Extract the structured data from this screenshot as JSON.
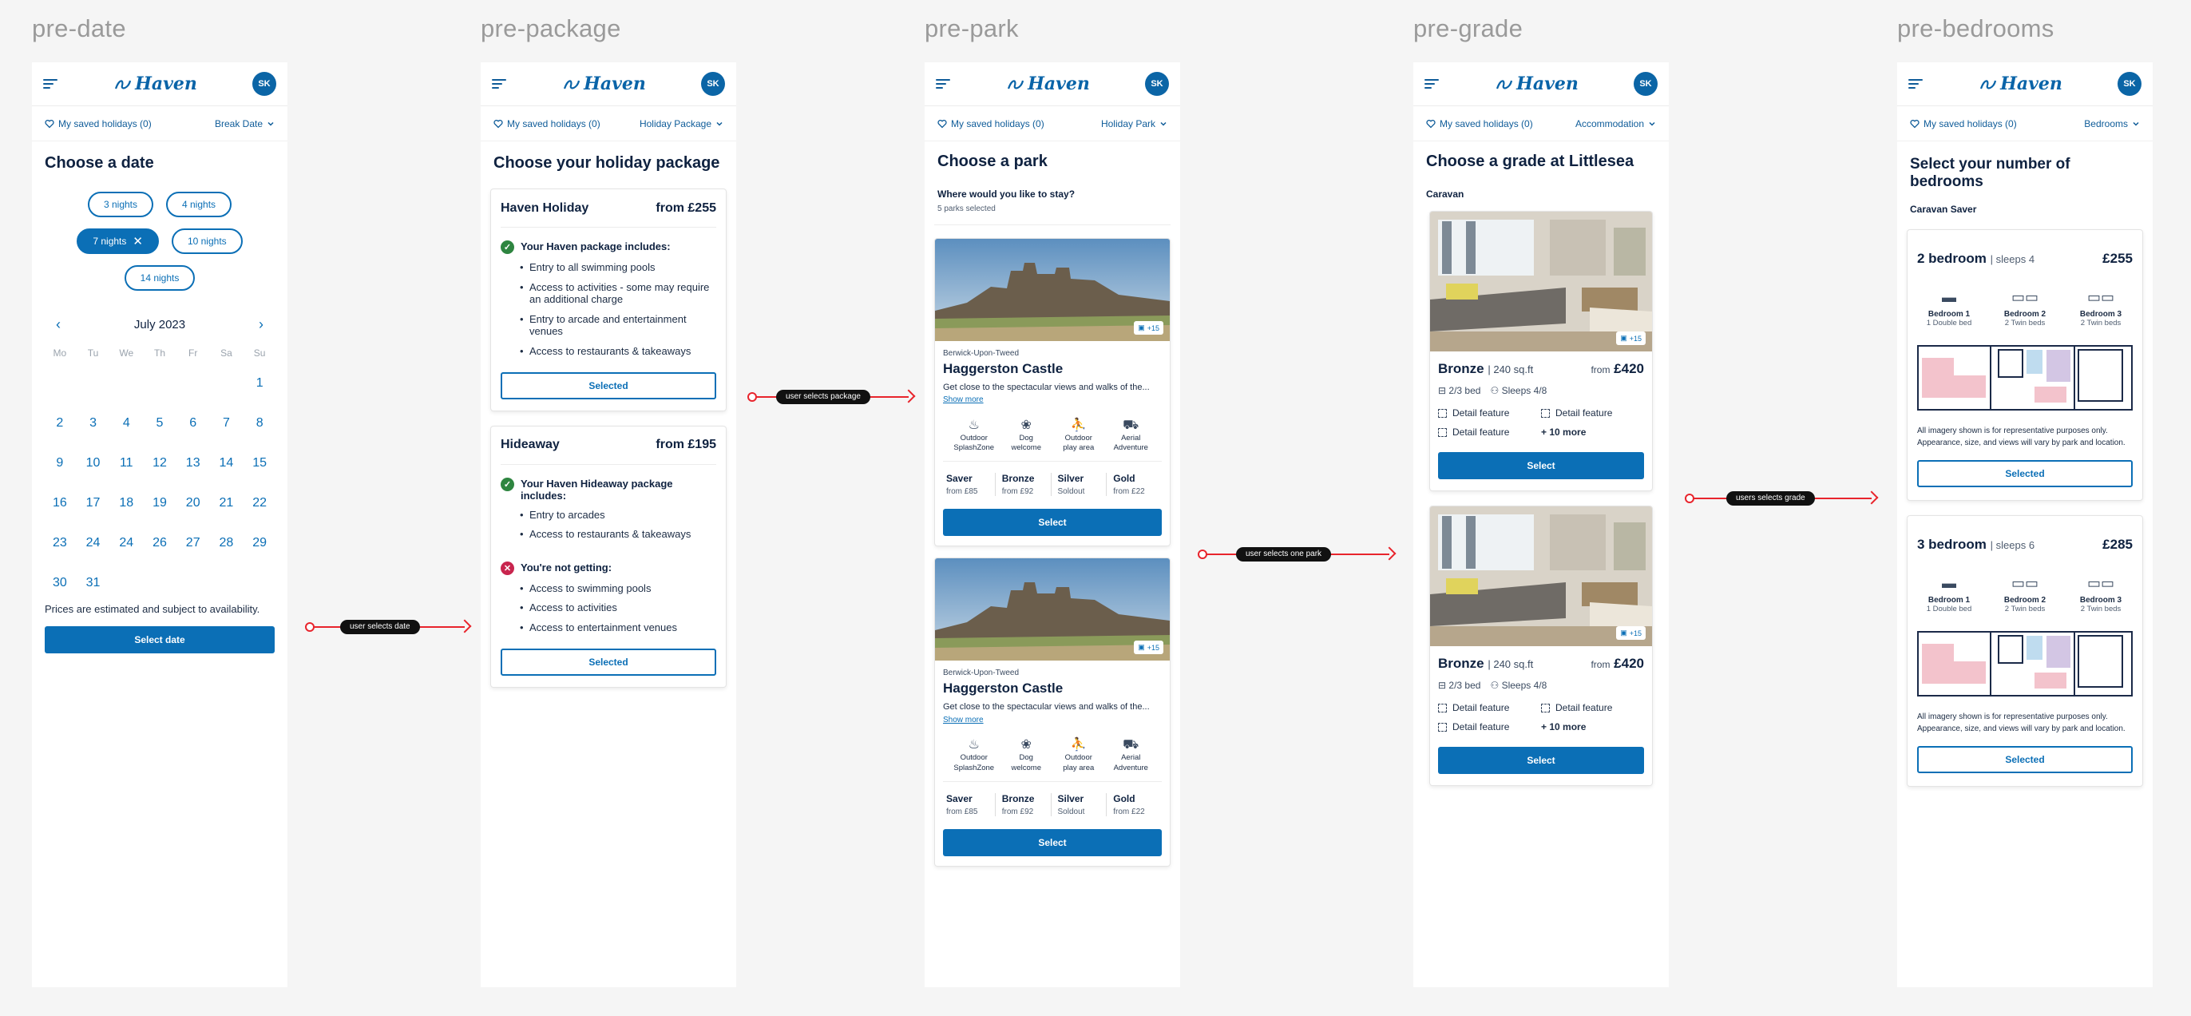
{
  "brand": {
    "logo": "Haven",
    "avatar": "SK",
    "saved": "My saved holidays (0)"
  },
  "frames": {
    "date": {
      "label": "pre-date",
      "filter": "Break Date",
      "title": "Choose a date",
      "chips": [
        "3 nights",
        "4 nights",
        "7 nights",
        "10 nights",
        "14 nights"
      ],
      "selected_chip": "7 nights",
      "month": "July 2023",
      "weekdays": [
        "Mo",
        "Tu",
        "We",
        "Th",
        "Fr",
        "Sa",
        "Su"
      ],
      "days": [
        "",
        "",
        "",
        "",
        "",
        "",
        "1",
        "2",
        "3",
        "4",
        "5",
        "6",
        "7",
        "8",
        "9",
        "10",
        "11",
        "12",
        "13",
        "14",
        "15",
        "16",
        "17",
        "18",
        "19",
        "20",
        "21",
        "22",
        "23",
        "24",
        "24",
        "26",
        "27",
        "28",
        "29",
        "30",
        "31"
      ],
      "note": "Prices are estimated and subject to availability.",
      "cta": "Select date"
    },
    "package": {
      "label": "pre-package",
      "filter": "Holiday Package",
      "title": "Choose your holiday package",
      "packages": [
        {
          "name": "Haven Holiday",
          "price": "from £255",
          "includes_title": "Your Haven package includes:",
          "includes": [
            "Entry to all swimming pools",
            "Access to activities - some may require an additional charge",
            "Entry to arcade and entertainment venues",
            "Access to restaurants & takeaways"
          ],
          "cta": "Selected"
        },
        {
          "name": "Hideaway",
          "price": "from £195",
          "includes_title": "Your Haven Hideaway package includes:",
          "includes": [
            "Entry to arcades",
            "Access to restaurants & takeaways"
          ],
          "excludes_title": "You're not getting:",
          "excludes": [
            "Access to swimming pools",
            "Access to activities",
            "Access to entertainment venues"
          ],
          "cta": "Selected"
        }
      ]
    },
    "park": {
      "label": "pre-park",
      "filter": "Holiday Park",
      "title": "Choose a park",
      "question": "Where would you like to stay?",
      "count": "5 parks selected",
      "parks": [
        {
          "badge": "+15",
          "location": "Berwick-Upon-Tweed",
          "name": "Haggerston Castle",
          "desc": "Get close to the spectacular views and walks of the...",
          "more": "Show more",
          "features": [
            {
              "icon": "splash-icon",
              "glyph": "♨",
              "line1": "Outdoor",
              "line2": "SplashZone"
            },
            {
              "icon": "dog-icon",
              "glyph": "❀",
              "line1": "Dog",
              "line2": "welcome"
            },
            {
              "icon": "playground-icon",
              "glyph": "⛹",
              "line1": "Outdoor",
              "line2": "play area"
            },
            {
              "icon": "aerial-icon",
              "glyph": "⛟",
              "line1": "Aerial",
              "line2": "Adventure"
            }
          ],
          "grades": [
            {
              "name": "Saver",
              "price": "from £85"
            },
            {
              "name": "Bronze",
              "price": "from £92"
            },
            {
              "name": "Silver",
              "price": "Soldout"
            },
            {
              "name": "Gold",
              "price": "from £22"
            }
          ],
          "cta": "Select"
        },
        {
          "badge": "+15",
          "location": "Berwick-Upon-Tweed",
          "name": "Haggerston Castle",
          "desc": "Get close to the spectacular views and walks of the...",
          "more": "Show more",
          "features": [
            {
              "icon": "splash-icon",
              "glyph": "♨",
              "line1": "Outdoor",
              "line2": "SplashZone"
            },
            {
              "icon": "dog-icon",
              "glyph": "❀",
              "line1": "Dog",
              "line2": "welcome"
            },
            {
              "icon": "playground-icon",
              "glyph": "⛹",
              "line1": "Outdoor",
              "line2": "play area"
            },
            {
              "icon": "aerial-icon",
              "glyph": "⛟",
              "line1": "Aerial",
              "line2": "Adventure"
            }
          ],
          "grades": [
            {
              "name": "Saver",
              "price": "from £85"
            },
            {
              "name": "Bronze",
              "price": "from £92"
            },
            {
              "name": "Silver",
              "price": "Soldout"
            },
            {
              "name": "Gold",
              "price": "from £22"
            }
          ],
          "cta": "Select"
        }
      ]
    },
    "grade": {
      "label": "pre-grade",
      "filter": "Accommodation",
      "title": "Choose a grade at Littlesea",
      "category": "Caravan",
      "cards": [
        {
          "badge": "+15",
          "name": "Bronze",
          "size": "| 240 sq.ft",
          "from": "from",
          "price": "£420",
          "beds": "2/3 bed",
          "sleeps": "Sleeps 4/8",
          "features": [
            "Detail feature",
            "Detail feature",
            "Detail feature",
            "+ 10 more"
          ],
          "cta": "Select"
        },
        {
          "badge": "+15",
          "name": "Bronze",
          "size": "| 240 sq.ft",
          "from": "from",
          "price": "£420",
          "beds": "2/3 bed",
          "sleeps": "Sleeps 4/8",
          "features": [
            "Detail feature",
            "Detail feature",
            "Detail feature",
            "+ 10 more"
          ],
          "cta": "Select"
        }
      ]
    },
    "bedrooms": {
      "label": "pre-bedrooms",
      "filter": "Bedrooms",
      "title": "Select your number of bedrooms",
      "category": "Caravan Saver",
      "cards": [
        {
          "name": "2 bedroom",
          "sleeps": "| sleeps 4",
          "price": "£255",
          "rooms": [
            {
              "name": "Bedroom 1",
              "beds": "1 Double bed"
            },
            {
              "name": "Bedroom 2",
              "beds": "2 Twin beds"
            },
            {
              "name": "Bedroom 3",
              "beds": "2 Twin beds"
            }
          ],
          "disclaimer": "All imagery shown is for representative purposes only. Appearance, size, and views will vary by park and location.",
          "cta": "Selected"
        },
        {
          "name": "3 bedroom",
          "sleeps": "| sleeps 6",
          "price": "£285",
          "rooms": [
            {
              "name": "Bedroom 1",
              "beds": "1 Double bed"
            },
            {
              "name": "Bedroom 2",
              "beds": "2 Twin beds"
            },
            {
              "name": "Bedroom 3",
              "beds": "2 Twin beds"
            }
          ],
          "disclaimer": "All imagery shown is for representative purposes only. Appearance, size, and views will vary by park and location.",
          "cta": "Selected"
        }
      ]
    }
  },
  "flows": [
    "user selects date",
    "user selects package",
    "user selects one park",
    "users selects grade"
  ],
  "colors": {
    "primary": "#0b6fb6",
    "navy": "#0f2240",
    "flow_red": "#e8242c",
    "ok_green": "#2e8540",
    "no_red": "#c8254e"
  }
}
